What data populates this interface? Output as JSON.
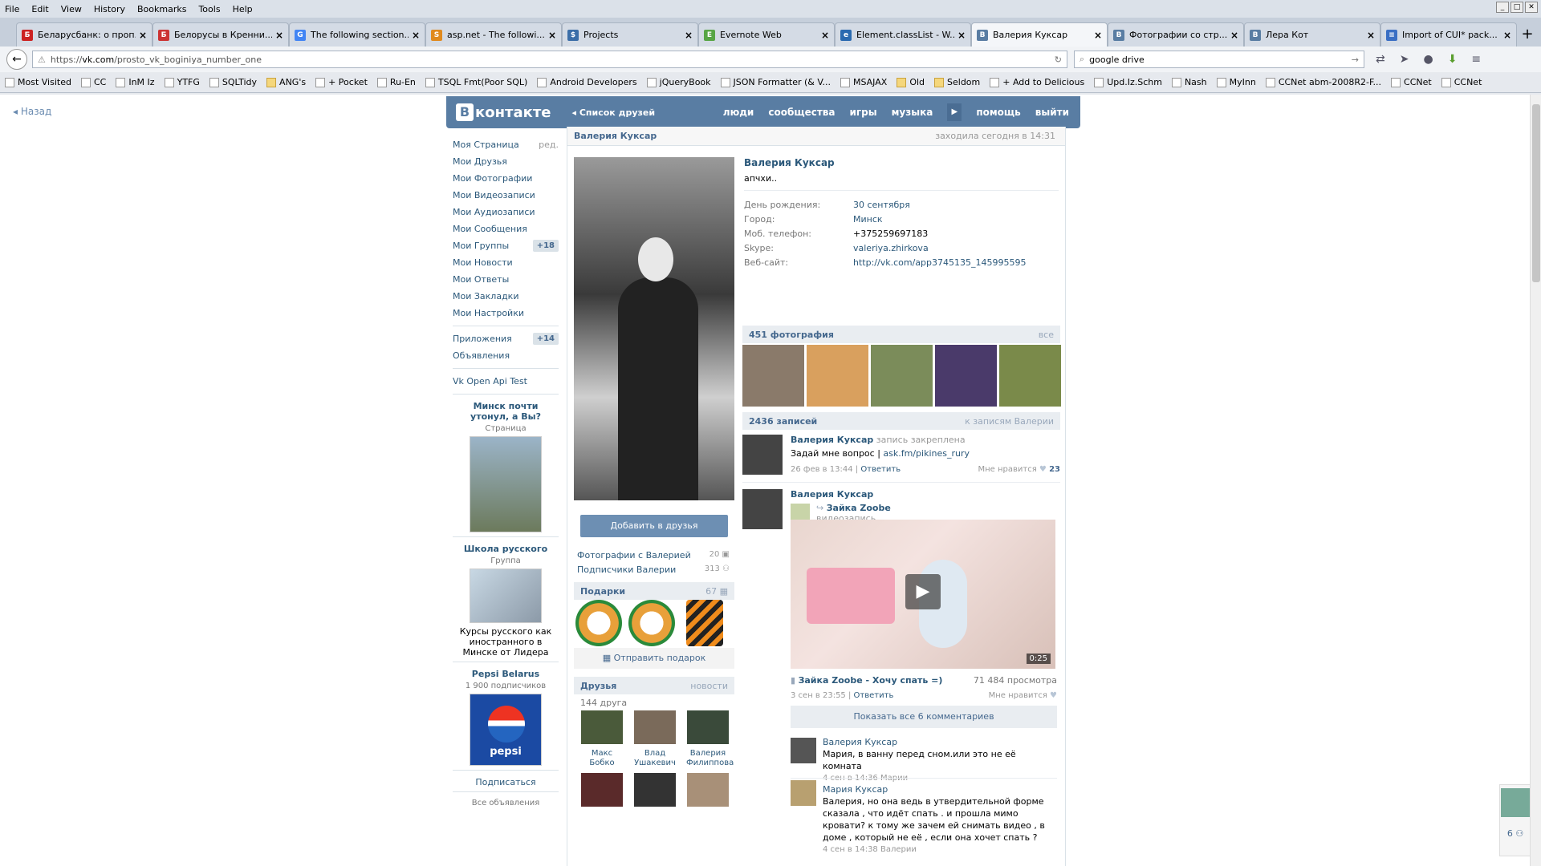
{
  "browser": {
    "menu": [
      "File",
      "Edit",
      "View",
      "History",
      "Bookmarks",
      "Tools",
      "Help"
    ],
    "tabs": [
      {
        "title": "Беларусбанк: о проп...",
        "color": "#cc2222",
        "glyph": "Б",
        "active": false
      },
      {
        "title": "Белорусы в Кренни...",
        "color": "#cc3333",
        "glyph": "Б",
        "active": false
      },
      {
        "title": "The following section...",
        "color": "#4285f4",
        "glyph": "G",
        "active": false
      },
      {
        "title": "asp.net - The followi...",
        "color": "#e08a1e",
        "glyph": "S",
        "active": false
      },
      {
        "title": "Projects",
        "color": "#3b6ea8",
        "glyph": "$",
        "active": false
      },
      {
        "title": "Evernote Web",
        "color": "#57a545",
        "glyph": "E",
        "active": false
      },
      {
        "title": "Element.classList - W...",
        "color": "#2a6ab0",
        "glyph": "e",
        "active": false
      },
      {
        "title": "Валерия Куксар",
        "color": "#597da3",
        "glyph": "B",
        "active": true
      },
      {
        "title": "Фотографии со стр...",
        "color": "#597da3",
        "glyph": "B",
        "active": false
      },
      {
        "title": "Лера Кот",
        "color": "#597da3",
        "glyph": "B",
        "active": false
      },
      {
        "title": "Import of CUI* pack...",
        "color": "#3a6fc4",
        "glyph": "≡",
        "active": false
      }
    ],
    "url_prefix": "https://",
    "url_host": "vk.com",
    "url_path": "/prosto_vk_boginiya_number_one",
    "search": "google drive",
    "bookmarks": [
      "Most Visited",
      "CC",
      "InM Iz",
      "YTFG",
      "SQLTidy",
      "ANG's",
      "+ Pocket",
      "Ru-En",
      "TSQL Fmt(Poor SQL)",
      "Android Developers",
      "jQueryBook",
      "JSON Formatter (& V...",
      "MSAJAX",
      "Old",
      "Seldom",
      "+ Add to Delicious",
      "Upd.Iz.Schm",
      "Nash",
      "MyInn",
      "CCNet abm-2008R2-F...",
      "CCNet",
      "CCNet"
    ]
  },
  "page": {
    "back": "Назад",
    "logo": "контакте",
    "friends_list": "Список друзей",
    "nav": [
      "люди",
      "сообщества",
      "игры",
      "музыка",
      "помощь",
      "выйти"
    ],
    "left_menu": [
      {
        "label": "Моя Страница",
        "extra": "ред."
      },
      {
        "label": "Мои Друзья",
        "extra": ""
      },
      {
        "label": "Мои Фотографии",
        "extra": ""
      },
      {
        "label": "Мои Видеозаписи",
        "extra": ""
      },
      {
        "label": "Мои Аудиозаписи",
        "extra": ""
      },
      {
        "label": "Мои Сообщения",
        "extra": ""
      },
      {
        "label": "Мои Группы",
        "extra": "+18"
      },
      {
        "label": "Мои Новости",
        "extra": ""
      },
      {
        "label": "Мои Ответы",
        "extra": ""
      },
      {
        "label": "Мои Закладки",
        "extra": ""
      },
      {
        "label": "Мои Настройки",
        "extra": ""
      }
    ],
    "left_menu2": [
      {
        "label": "Приложения",
        "extra": "+14"
      },
      {
        "label": "Объявления",
        "extra": ""
      }
    ],
    "app_link": "Vk Open Api Test",
    "ads": [
      {
        "title": "Минск почти утонул, а Вы?",
        "sub": "Страница",
        "desc": ""
      },
      {
        "title": "Школа русского",
        "sub": "Группа",
        "desc": "Курсы русского как иностранного в Минске от Лидера"
      },
      {
        "title": "Pepsi Belarus",
        "sub": "1 900 подписчиков",
        "desc": ""
      }
    ],
    "subscribe": "Подписаться",
    "all_ads": "Все объявления",
    "profile": {
      "name_bar": "Валерия Куксар",
      "last_seen": "заходила сегодня в 14:31",
      "name": "Валерия Куксар",
      "status": "апчхи..",
      "rows": [
        {
          "k": "День рождения:",
          "v": "30 сентября"
        },
        {
          "k": "Город:",
          "v": "Минск"
        },
        {
          "k": "Моб. телефон:",
          "v": "+375259697183"
        },
        {
          "k": "Skype:",
          "v": "valeriya.zhirkova"
        },
        {
          "k": "Веб-сайт:",
          "v": "http://vk.com/app3745135_145995595"
        }
      ],
      "add_friend": "Добавить в друзья",
      "photos_with": "Фотографии с Валерией",
      "photos_with_count": "20",
      "followers": "Подписчики Валерии",
      "followers_count": "313",
      "gifts": "Подарки",
      "gifts_count": "67",
      "send_gift": "Отправить подарок",
      "friends": "Друзья",
      "friends_news": "новости",
      "friends_count": "144 друга",
      "friend_list": [
        {
          "name": "Макс Бобко"
        },
        {
          "name": "Влад Ушакевич"
        },
        {
          "name": "Валерия Филиппова"
        }
      ]
    },
    "photos_bar": "451 фотография",
    "photos_all": "все",
    "photo_colors": [
      "#8a7a6a",
      "#d9a05e",
      "#7b8c5a",
      "#4a3a6a",
      "#7a8a4a"
    ],
    "wall_bar": "2436 записей",
    "wall_link": "к записям Валерии",
    "post1": {
      "author": "Валерия Куксар",
      "pinned": "запись закреплена",
      "text": "Задай мне вопрос |",
      "link": "ask.fm/pikines_rury",
      "date": "26 фев в 13:44",
      "reply": "Ответить",
      "like": "Мне нравится",
      "likes": "23"
    },
    "post2": {
      "author": "Валерия Куксар",
      "repost": "Зайка Zoobe",
      "repost_type": "видеозапись",
      "duration": "0:25",
      "video_title": "Зайка Zoobe - Хочу спать =)",
      "views": "71 484 просмотра",
      "date": "3 сен в 23:55",
      "reply": "Ответить",
      "like": "Мне нравится",
      "show_all": "Показать все 6 комментариев"
    },
    "comments": [
      {
        "author": "Валерия Куксар",
        "text": "Мария, в ванну перед сном.или это не её комната",
        "date": "4 сен в 14:36 Марии"
      },
      {
        "author": "Мария Куксар",
        "text": "Валерия, но она ведь в утвердительной форме сказала , что идёт спать . и прошла мимо кровати? к тому же зачем ей снимать видео , в доме , который не её , если она хочет спать ?",
        "date": "4 сен в 14:38 Валерии"
      }
    ],
    "widget_count": "6"
  }
}
